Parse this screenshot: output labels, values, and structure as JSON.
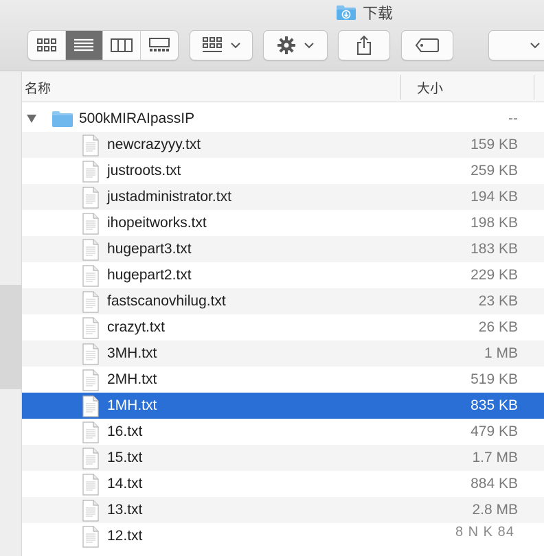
{
  "window": {
    "title": "下载"
  },
  "toolbar": {
    "view_modes": [
      {
        "name": "icon-view-icon",
        "active": false
      },
      {
        "name": "list-view-icon",
        "active": true
      },
      {
        "name": "column-view-icon",
        "active": false
      },
      {
        "name": "gallery-view-icon",
        "active": false
      }
    ],
    "group_icon": "group-grid-icon",
    "action_icon": "gear-icon",
    "share_icon": "share-icon",
    "tag_icon": "tag-icon"
  },
  "columns": {
    "name": "名称",
    "size": "大小"
  },
  "folder": {
    "name": "500kMIRAIpassIP",
    "size": "--",
    "expanded": true
  },
  "files": [
    {
      "name": "newcrazyyy.txt",
      "size": "159 KB"
    },
    {
      "name": "justroots.txt",
      "size": "259 KB"
    },
    {
      "name": "justadministrator.txt",
      "size": "194 KB"
    },
    {
      "name": "ihopeitworks.txt",
      "size": "198 KB"
    },
    {
      "name": "hugepart3.txt",
      "size": "183 KB"
    },
    {
      "name": "hugepart2.txt",
      "size": "229 KB"
    },
    {
      "name": "fastscanovhilug.txt",
      "size": "23 KB"
    },
    {
      "name": "crazyt.txt",
      "size": "26 KB"
    },
    {
      "name": "3MH.txt",
      "size": "1 MB"
    },
    {
      "name": "2MH.txt",
      "size": "519 KB"
    },
    {
      "name": "1MH.txt",
      "size": "835 KB",
      "selected": true
    },
    {
      "name": "16.txt",
      "size": "479 KB"
    },
    {
      "name": "15.txt",
      "size": "1.7 MB"
    },
    {
      "name": "14.txt",
      "size": "884 KB"
    },
    {
      "name": "13.txt",
      "size": "2.8 MB"
    },
    {
      "name": "12.txt",
      "size": ""
    }
  ],
  "watermark": "8 N K 84",
  "colors": {
    "selection": "#2a6fd6",
    "folder": "#6fb8ee",
    "toolbar": "#e4e4e4"
  }
}
